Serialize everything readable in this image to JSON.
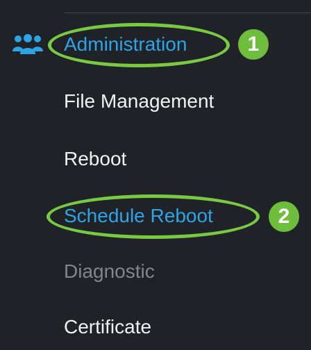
{
  "colors": {
    "background": "#1f2327",
    "link_blue": "#2ea4e6",
    "text_white": "#f2f2f2",
    "text_disabled": "#80868c",
    "highlight_green": "#7ac943",
    "badge_green": "#6ebd3c"
  },
  "nav": {
    "section_icon": "users-group-icon",
    "section_label": "Administration",
    "items": [
      {
        "label": "File Management"
      },
      {
        "label": "Reboot"
      },
      {
        "label": "Schedule Reboot"
      },
      {
        "label": "Diagnostic"
      },
      {
        "label": "Certificate"
      }
    ]
  },
  "annotations": {
    "step1": "1",
    "step2": "2"
  }
}
